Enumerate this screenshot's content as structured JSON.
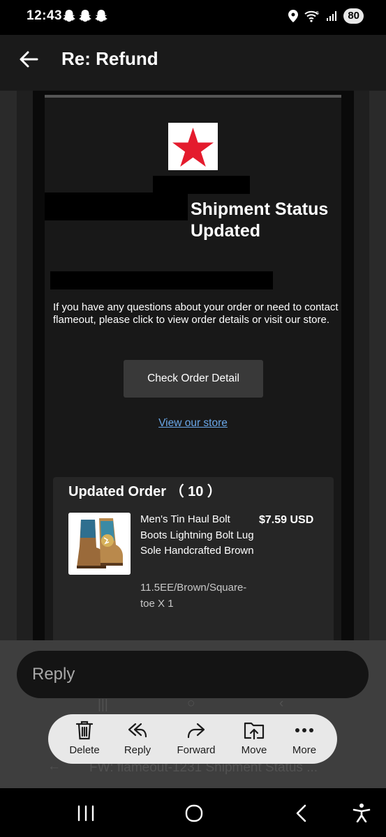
{
  "status_bar": {
    "time": "12:43",
    "battery": "80"
  },
  "header": {
    "title": "Re: Refund"
  },
  "email": {
    "headline": "Shipment Status Updated",
    "intro": "If you have any questions about your order or need to contact flameout, please click to view order details or visit our store.",
    "check_order_label": "Check Order Detail",
    "view_store_label": "View our store",
    "order": {
      "title": "Updated Order （ 10 ）",
      "product_name": "Men's Tin Haul Bolt Boots Lightning Bolt Lug Sole Handcrafted Brown",
      "price": "$7.59 USD",
      "variant": "11.5EE/Brown/Square-toe X 1"
    }
  },
  "reply": {
    "placeholder": "Reply"
  },
  "background_subject": "FW: flameout-1231 Shipment Status ...",
  "toolbar": {
    "delete_label": "Delete",
    "reply_label": "Reply",
    "forward_label": "Forward",
    "move_label": "Move",
    "more_label": "More"
  },
  "colors": {
    "link": "#6aa7e8",
    "logo_star": "#e41b2d"
  }
}
